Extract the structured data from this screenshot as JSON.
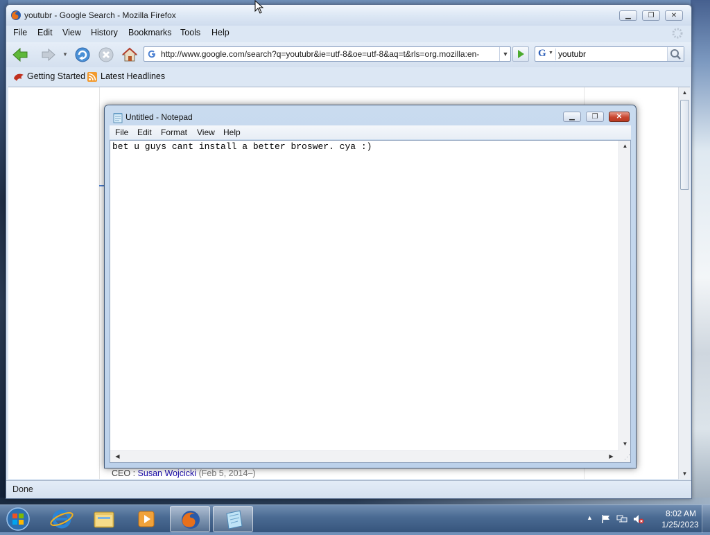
{
  "firefox": {
    "title": "youtubr - Google Search - Mozilla Firefox",
    "menu": [
      "File",
      "Edit",
      "View",
      "History",
      "Bookmarks",
      "Tools",
      "Help"
    ],
    "url": "http://www.google.com/search?q=youtubr&ie=utf-8&oe=utf-8&aq=t&rls=org.mozilla:en-",
    "search_query": "youtubr",
    "bookmarks": [
      "Getting Started",
      "Latest Headlines"
    ],
    "page": {
      "ceo_label": "CEO",
      "ceo_separator": ":",
      "ceo_name": "Susan Wojcicki",
      "ceo_dates": "(Feb 5, 2014–)"
    },
    "status": "Done"
  },
  "notepad": {
    "title": "Untitled - Notepad",
    "menu": [
      "File",
      "Edit",
      "Format",
      "View",
      "Help"
    ],
    "text": "bet u guys cant install a better broswer. cya :)"
  },
  "taskbar": {
    "items": [
      "start-orb-icon",
      "internet-explorer-icon",
      "windows-explorer-icon",
      "media-player-icon",
      "firefox-icon",
      "notepad-icon"
    ],
    "active": [
      "firefox-icon",
      "notepad-icon"
    ],
    "clock_time": "8:02 AM",
    "clock_date": "1/25/2023"
  },
  "colors": {
    "link": "#1a0dab",
    "close_red": "#c7452e",
    "taskbar": "#4a6a92"
  }
}
